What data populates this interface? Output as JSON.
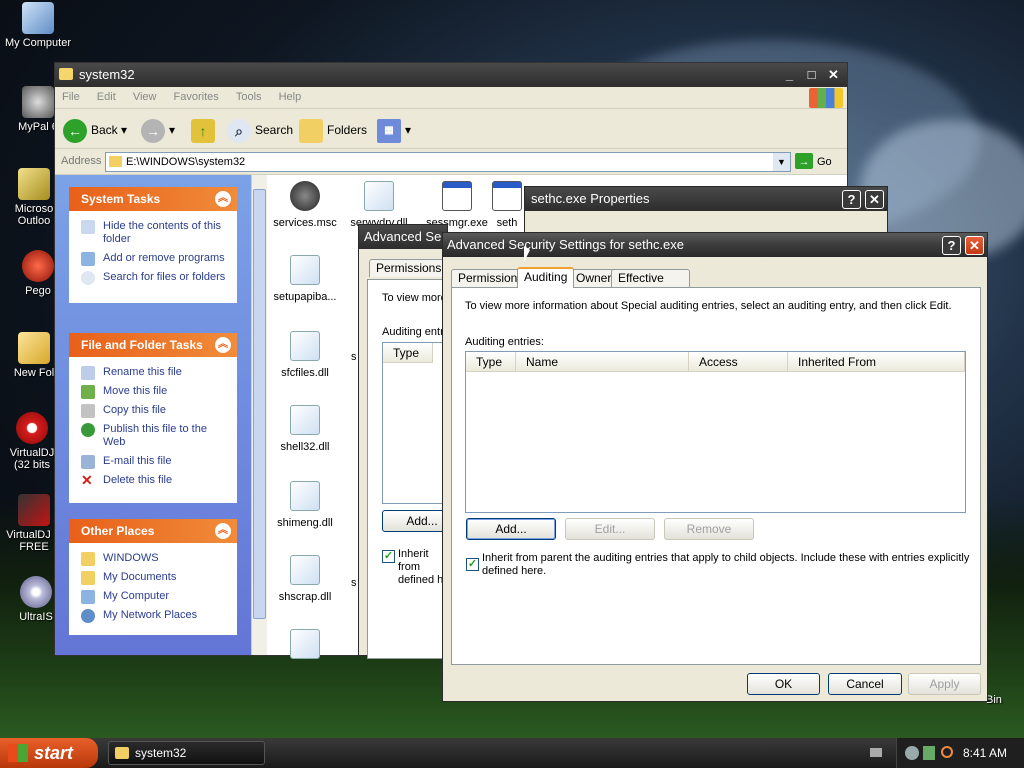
{
  "desktop": {
    "icons": [
      {
        "label": "My Computer"
      },
      {
        "label": "MyPal 6"
      },
      {
        "label": "Microso Outloo"
      },
      {
        "label": "Pego"
      },
      {
        "label": "New Fol"
      },
      {
        "label": "VirtualDJ (32 bits"
      },
      {
        "label": "VirtualDJ H FREE"
      },
      {
        "label": "UltraIS"
      }
    ],
    "recycle_label": "Bin"
  },
  "explorer": {
    "title": "system32",
    "menu": [
      "File",
      "Edit",
      "View",
      "Favorites",
      "Tools",
      "Help"
    ],
    "toolbar": {
      "back": "Back",
      "search": "Search",
      "folders": "Folders"
    },
    "address_label": "Address",
    "address_value": "E:\\WINDOWS\\system32",
    "go": "Go",
    "system_tasks": {
      "title": "System Tasks",
      "items": [
        "Hide the contents of this folder",
        "Add or remove programs",
        "Search for files or folders"
      ]
    },
    "file_tasks": {
      "title": "File and Folder Tasks",
      "items": [
        "Rename this file",
        "Move this file",
        "Copy this file",
        "Publish this file to the Web",
        "E-mail this file",
        "Delete this file"
      ]
    },
    "other_places": {
      "title": "Other Places",
      "items": [
        "WINDOWS",
        "My Documents",
        "My Computer",
        "My Network Places"
      ]
    },
    "files": [
      "services.msc",
      "serwvdrv.dll",
      "sessmgr.exe",
      "seth",
      "setupapiba...",
      "sfcfiles.dll",
      "shell32.dll",
      "shimeng.dll",
      "shscrap.dll",
      "s",
      "s"
    ]
  },
  "props_dialog": {
    "title": "sethc.exe Properties"
  },
  "back_dialog": {
    "title": "Advanced Se",
    "tab": "Permissions",
    "desc": "To view more",
    "entries_label": "Auditing entri",
    "col_type": "Type",
    "add": "Add...",
    "inherit": "Inherit from defined h"
  },
  "adv_dialog": {
    "title": "Advanced Security Settings for sethc.exe",
    "tabs": [
      "Permissions",
      "Auditing",
      "Owner",
      "Effective Permissions"
    ],
    "description": "To view more information about Special auditing entries, select an auditing entry, and then click Edit.",
    "entries_label": "Auditing entries:",
    "columns": [
      "Type",
      "Name",
      "Access",
      "Inherited From"
    ],
    "buttons": {
      "add": "Add...",
      "edit": "Edit...",
      "remove": "Remove"
    },
    "inherit_text": "Inherit from parent the auditing entries that apply to child objects. Include these with entries explicitly defined here.",
    "footer": {
      "ok": "OK",
      "cancel": "Cancel",
      "apply": "Apply"
    }
  },
  "taskbar": {
    "start": "start",
    "task": "system32",
    "clock": "8:41 AM"
  }
}
